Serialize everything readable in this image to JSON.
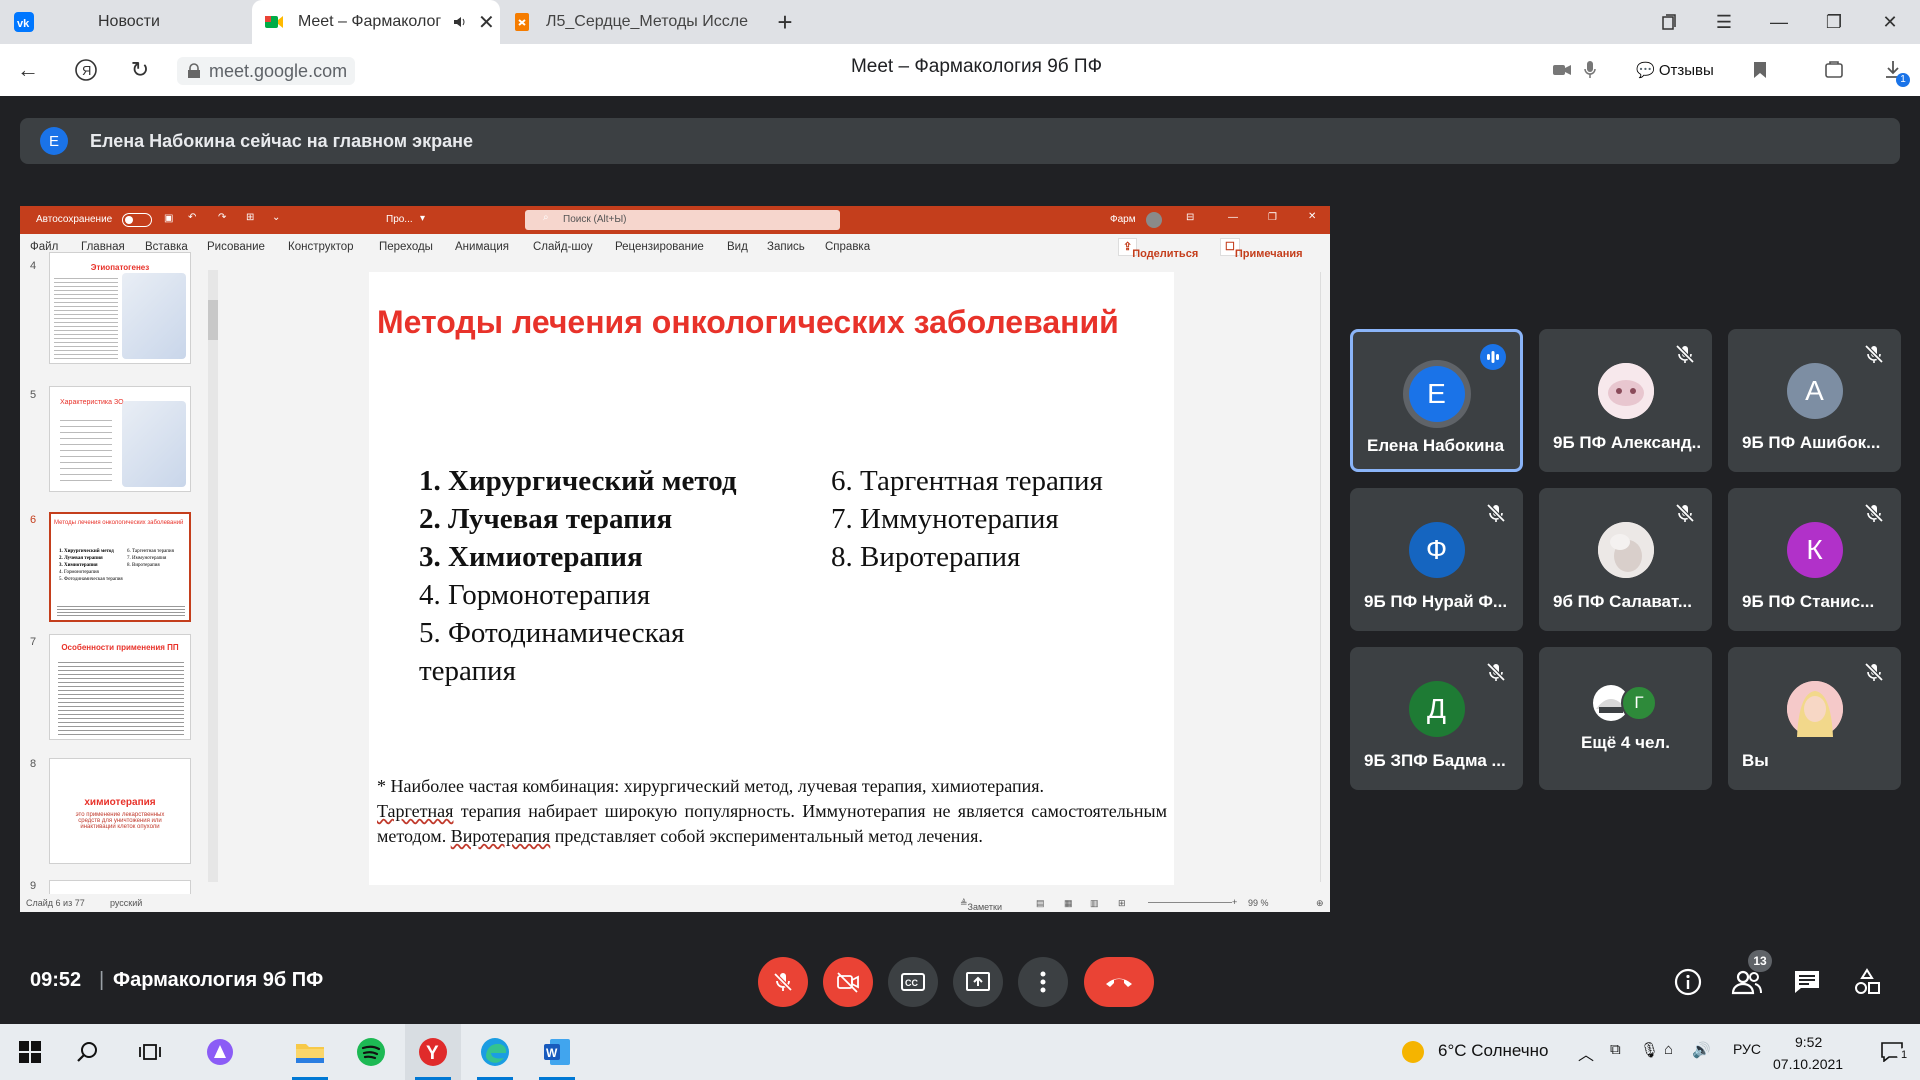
{
  "browser": {
    "tabs": [
      {
        "label": "Новости",
        "icon": "vk-icon"
      },
      {
        "label": "Meet – Фармаколог",
        "icon": "google-meet-icon",
        "active": true
      },
      {
        "label": "Л5_Сердце_Методы Иссле",
        "icon": "document-icon"
      }
    ],
    "url": "meet.google.com",
    "page_title": "Meet – Фармакология 9б ПФ",
    "feedback": "Отзывы",
    "download_count": "1"
  },
  "banner": {
    "avatar": "Е",
    "text": "Елена Набокина сейчас на главном экране"
  },
  "powerpoint": {
    "autosave": "Автосохранение",
    "doc_name": "Про...",
    "search_placeholder": "Поиск (Alt+Ы)",
    "user": "Фарм",
    "menu": [
      "Файл",
      "Главная",
      "Вставка",
      "Рисование",
      "Конструктор",
      "Переходы",
      "Анимация",
      "Слайд-шоу",
      "Рецензирование",
      "Вид",
      "Запись",
      "Справка"
    ],
    "share": "Поделиться",
    "comments": "Примечания",
    "thumb_numbers": [
      "4",
      "5",
      "6",
      "7",
      "8",
      "9"
    ],
    "thumbs": {
      "t4_title": "Этиопатогенез",
      "t5_title": "Характеристика ЗО",
      "t6_title": "Методы лечения онкологических заболеваний",
      "t6_left": [
        "1. Хирургический метод",
        "2. Лучевая терапия",
        "3. Химиотерапия",
        "4. Гормонотерапия",
        "5. Фотодинамическая терапия"
      ],
      "t6_right": [
        "6. Таргентная терапия",
        "7. Иммунотерапия",
        "8. Виротерапия"
      ],
      "t7_title": "Особенности применения ПП",
      "t8_title": "химиотерапия",
      "t8_text": "это применение лекарственных средств для уничтожения или инактивации клеток опухоли"
    },
    "slide": {
      "title": "Методы лечения онкологических заболеваний",
      "left": [
        "1.   Хирургический метод",
        "2. Лучевая терапия",
        "3. Химиотерапия",
        "4. Гормонотерапия",
        "5. Фотодинамическая",
        "терапия"
      ],
      "right": [
        "6. Таргентная терапия",
        "7. Иммунотерапия",
        "8. Виротерапия"
      ],
      "footnote_1": "* Наиболее частая комбинация: хирургический метод, лучевая терапия, химиотерапия.",
      "footnote_2a": "Таргетная",
      "footnote_2b": " терапия набирает широкую популярность. Иммунотерапия не является самостоятельным методом. ",
      "footnote_2c": "Виротерапия",
      "footnote_2d": " представляет собой экспериментальный метод лечения."
    },
    "status": {
      "slide": "Слайд 6 из 77",
      "lang": "русский",
      "notes": "Заметки",
      "zoom": "99 %"
    }
  },
  "participants": [
    {
      "name": "Елена Набокина",
      "avatar": "Е",
      "color": "#1a73e8",
      "speaking": true
    },
    {
      "name": "9Б ПФ Александ...",
      "avatar": "",
      "color": "#f3dde3",
      "muted": true,
      "photo": true
    },
    {
      "name": "9Б ПФ Ашибок...",
      "avatar": "А",
      "color": "#7d8ea3",
      "muted": true
    },
    {
      "name": "9Б ПФ Нурай Ф...",
      "avatar": "Ф",
      "color": "#1565c0",
      "muted": true
    },
    {
      "name": "9б ПФ Салават...",
      "avatar": "",
      "color": "#e9e4e4",
      "muted": true,
      "photo": true
    },
    {
      "name": "9Б ПФ Станис...",
      "avatar": "К",
      "color": "#b131c9",
      "muted": true
    },
    {
      "name": "9Б ЗПФ Бадма ...",
      "avatar": "Д",
      "color": "#1e7b34",
      "muted": true
    },
    {
      "name": "Ещё 4 чел.",
      "avatar": "Г",
      "color": "#2e8a3a"
    },
    {
      "name": "Вы",
      "avatar": "",
      "color": "#f0b7b7",
      "muted": true,
      "photo": true
    }
  ],
  "meeting_bar": {
    "time": "09:52",
    "separator": "|",
    "name": "Фармакология 9б ПФ",
    "people_count": "13"
  },
  "taskbar": {
    "weather": "6°C  Солнечно",
    "lang": "РУС",
    "time": "9:52",
    "date": "07.10.2021",
    "notif": "1"
  }
}
